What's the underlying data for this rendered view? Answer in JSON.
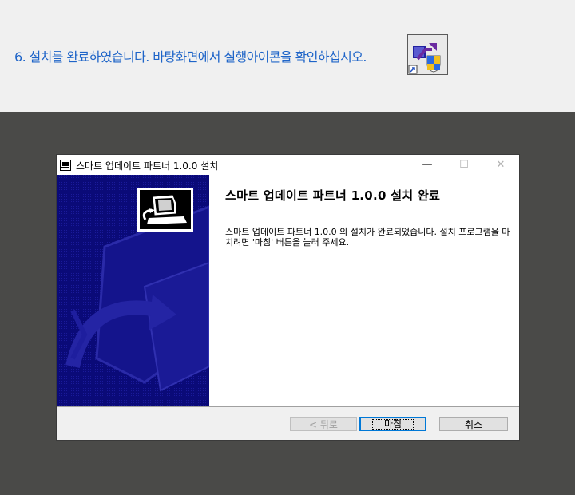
{
  "instruction": "6. 설치를 완료하였습니다. 바탕화면에서 실행아이콘을 확인하십시오.",
  "window": {
    "title": "스마트 업데이트 파트너 1.0.0  설치",
    "controls": {
      "minimize": "—",
      "maximize": "☐",
      "close": "✕"
    }
  },
  "content": {
    "heading": "스마트 업데이트 파트너 1.0.0  설치 완료",
    "body": "스마트 업데이트 파트너 1.0.0 의 설치가 완료되었습니다. 설치 프로그램을 마치려면 '마침' 버튼을 눌러 주세요."
  },
  "buttons": {
    "back": "< 뒤로",
    "finish": "마침",
    "cancel": "취소"
  },
  "colors": {
    "instruction_text": "#1e64c8",
    "side_panel": "#0a0a78",
    "dark_background": "#4a4a48"
  },
  "icons": [
    "shortcut-app-icon",
    "installer-icon",
    "computer-arrow-graphic"
  ]
}
